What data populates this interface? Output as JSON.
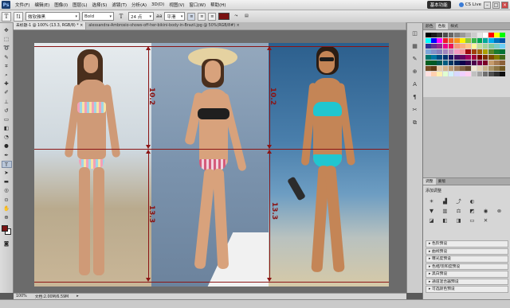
{
  "app": {
    "logo": "Ps",
    "workspace_button": "基本功能",
    "cs_live": "CS Live"
  },
  "menu": [
    "文件(F)",
    "编辑(E)",
    "图像(I)",
    "图层(L)",
    "选择(S)",
    "滤镜(T)",
    "分析(A)",
    "3D(D)",
    "视图(V)",
    "窗口(W)",
    "帮助(H)"
  ],
  "options_bar": {
    "tool_glyph": "T",
    "font_family": "微软雅黑",
    "font_style": "Bold",
    "font_size": "24 点",
    "aa_label": "aa",
    "aa_mode": "平滑",
    "text_color": "#7a1212"
  },
  "tabs": {
    "active": "未标题-1 @ 100% (13.3, RGB/8) * ×",
    "inactive": "alessandra-Ambrosio-shows-off-her-bikini-body-in-Brazil.jpg @ 50%(RGB/8#) ×"
  },
  "canvas": {
    "guide_color": "#8b1515",
    "measure_top_left": "10.2",
    "measure_top_right": "10.2",
    "measure_bottom_mid": "13.3",
    "measure_bottom_right": "13.3"
  },
  "status": {
    "zoom": "100%",
    "doc": "文档:2.00M/6.59M"
  },
  "right_panel": {
    "top_tabs": [
      "颜色",
      "色板",
      "样式"
    ],
    "active_top_tab": "色板",
    "adjust_tabs": [
      "调整",
      "蒙版"
    ],
    "adjust_title": "添加调整",
    "presets": [
      "色阶预设",
      "曲线预设",
      "曝光度预设",
      "色相/饱和度预设",
      "黑白预设",
      "通道混合器预设",
      "可选颜色预设"
    ]
  },
  "swatch_colors": [
    "#000000",
    "#1a1a1a",
    "#333333",
    "#4d4d4d",
    "#666666",
    "#808080",
    "#999999",
    "#b3b3b3",
    "#cccccc",
    "#e6e6e6",
    "#ffffff",
    "#ff0000",
    "#ffff00",
    "#00ff00",
    "#00ffff",
    "#0000ff",
    "#ff00ff",
    "#ed1c24",
    "#f26522",
    "#f7941d",
    "#fff200",
    "#8dc63f",
    "#39b54a",
    "#00a651",
    "#00a99d",
    "#00aeef",
    "#0072bc",
    "#0054a6",
    "#2e3192",
    "#662d91",
    "#92278f",
    "#ec008c",
    "#ed145b",
    "#f69679",
    "#f9ad81",
    "#fdc68a",
    "#fff799",
    "#c4df9b",
    "#a3d39c",
    "#82ca9c",
    "#7accc8",
    "#6dcff6",
    "#7da7d9",
    "#8393ca",
    "#8781bd",
    "#a186be",
    "#bd8cbf",
    "#f49ac2",
    "#f6989d",
    "#9e0b0f",
    "#a0410d",
    "#a36209",
    "#aba000",
    "#598527",
    "#1a7b30",
    "#007236",
    "#00746b",
    "#0076a3",
    "#004a80",
    "#003471",
    "#1b1464",
    "#440e62",
    "#630460",
    "#9e005d",
    "#9e0039",
    "#790000",
    "#7b2e00",
    "#7d4900",
    "#827b00",
    "#406618",
    "#005e20",
    "#005826",
    "#005952",
    "#005b7f",
    "#003663",
    "#002157",
    "#0d004c",
    "#32004b",
    "#4b0049",
    "#7b0046",
    "#7a0026",
    "#c69c6d",
    "#a67c52",
    "#8c6239",
    "#754c24",
    "#603913",
    "#e6c9a8",
    "#d4b48c",
    "#b89874",
    "#9c7c5c",
    "#806244",
    "#64482d",
    "#f0e6d2",
    "#e2d3b5",
    "#c7b38d",
    "#aa9467",
    "#8d7543",
    "#705822",
    "#ffe0e0",
    "#ffd0b0",
    "#fff0b0",
    "#e0ffd0",
    "#d0f0ff",
    "#d8d8ff",
    "#f0d0ff",
    "#ffd0f0",
    "#c0c0c0",
    "#a0a0a0",
    "#707070",
    "#505050",
    "#303030",
    "#101010"
  ]
}
